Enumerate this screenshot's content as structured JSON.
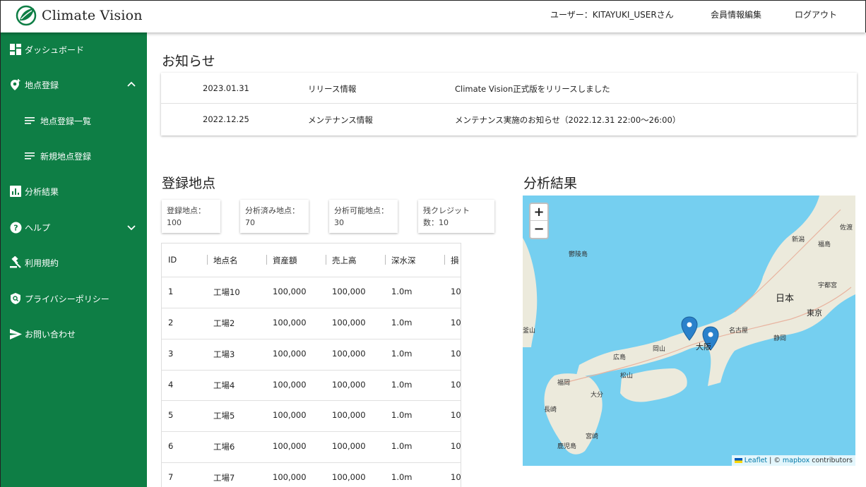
{
  "header": {
    "app_name": "Climate Vision",
    "user_label": "ユーザー：KITAYUKI_USERさん",
    "profile_edit": "会員情報編集",
    "logout": "ログアウト"
  },
  "sidebar": {
    "items": [
      {
        "label": "ダッシュボード",
        "icon": "dashboard-icon"
      },
      {
        "label": "地点登録",
        "icon": "add-location-icon"
      },
      {
        "label": "地点登録一覧",
        "icon": "list-icon"
      },
      {
        "label": "新規地点登録",
        "icon": "list-icon"
      },
      {
        "label": "分析結果",
        "icon": "chart-icon"
      },
      {
        "label": "ヘルプ",
        "icon": "help-icon"
      },
      {
        "label": "利用規約",
        "icon": "gavel-icon"
      },
      {
        "label": "プライバシーポリシー",
        "icon": "privacy-icon"
      },
      {
        "label": "お問い合わせ",
        "icon": "send-icon"
      }
    ]
  },
  "news": {
    "title": "お知らせ",
    "rows": [
      {
        "date": "2023.01.31",
        "category": "リリース情報",
        "text": "Climate Vision正式版をリリースしました"
      },
      {
        "date": "2022.12.25",
        "category": "メンテナンス情報",
        "text": "メンテナンス実施のお知らせ（2022.12.31 22:00〜26:00）"
      }
    ]
  },
  "sites": {
    "title": "登録地点",
    "stats": [
      {
        "line1": "登録地点：",
        "line2": "100"
      },
      {
        "line1": "分析済み地点：",
        "line2": "70"
      },
      {
        "line1": "分析可能地点：",
        "line2": "30"
      },
      {
        "line1": "残クレジット",
        "line2": "数：10"
      }
    ],
    "columns": [
      "ID",
      "地点名",
      "資産額",
      "売上高",
      "深水深",
      "損"
    ],
    "rows": [
      [
        "1",
        "工場10",
        "100,000",
        "100,000",
        "1.0m",
        "10"
      ],
      [
        "2",
        "工場2",
        "100,000",
        "100,000",
        "1.0m",
        "10"
      ],
      [
        "3",
        "工場3",
        "100,000",
        "100,000",
        "1.0m",
        "10"
      ],
      [
        "4",
        "工場4",
        "100,000",
        "100,000",
        "1.0m",
        "10"
      ],
      [
        "5",
        "工場5",
        "100,000",
        "100,000",
        "1.0m",
        "10"
      ],
      [
        "6",
        "工場6",
        "100,000",
        "100,000",
        "1.0m",
        "10"
      ],
      [
        "7",
        "工場7",
        "100,000",
        "100,000",
        "1.0m",
        "10"
      ]
    ]
  },
  "analysis": {
    "title": "分析結果",
    "zoom_in": "+",
    "zoom_out": "−",
    "attribution_leaflet": "Leaflet",
    "attribution_sep": " | © ",
    "attribution_mapbox": "mapbox",
    "attribution_rest": " contributors",
    "labels": {
      "niigata": "新潟",
      "sado": "佐渡",
      "fukushima": "福島",
      "utsunomiya": "宇都宮",
      "utsuryo": "鬱陵島",
      "japan": "日本",
      "tokyo": "東京",
      "nagoya": "名古屋",
      "shizuoka": "静岡",
      "busan": "釜山",
      "okayama": "岡山",
      "osaka": "大阪",
      "hiroshima": "広島",
      "matsuyama": "松山",
      "fukuoka": "福岡",
      "oita": "大分",
      "nagasaki": "長崎",
      "miyazaki": "宮崎",
      "kagoshima": "鹿児島"
    }
  }
}
